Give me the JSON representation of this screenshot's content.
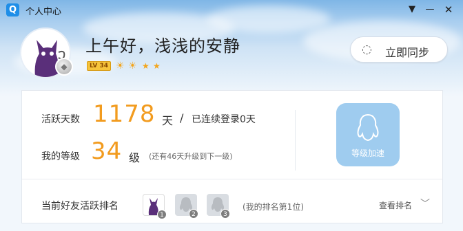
{
  "window": {
    "app_logo": "Q",
    "title": "个人中心",
    "menu_icon": "menu-triangle-icon",
    "minimize_icon": "minimize-icon",
    "close_icon": "close-icon"
  },
  "header": {
    "greeting": "上午好，浅浅的安静",
    "level_badge": "LV 34",
    "level_icons": [
      "sun",
      "sun",
      "star",
      "star"
    ],
    "sync_label": "立即同步"
  },
  "stats": {
    "active_days_label": "活跃天数",
    "active_days_value": "1178",
    "active_days_unit": "天",
    "separator": "/",
    "streak_text": "已连续登录0天",
    "level_label": "我的等级",
    "level_value": "34",
    "level_unit": "级",
    "level_hint": "(还有46天升级到下一级)"
  },
  "boost": {
    "label": "等级加速"
  },
  "ranking": {
    "title": "当前好友活跃排名",
    "ranks": [
      "1",
      "2",
      "3"
    ],
    "note": "(我的排名第1位)",
    "view_label": "查看排名"
  },
  "colors": {
    "accent_orange": "#f29b1e",
    "boost_blue": "#9fccef",
    "app_blue": "#1e8ee8"
  }
}
